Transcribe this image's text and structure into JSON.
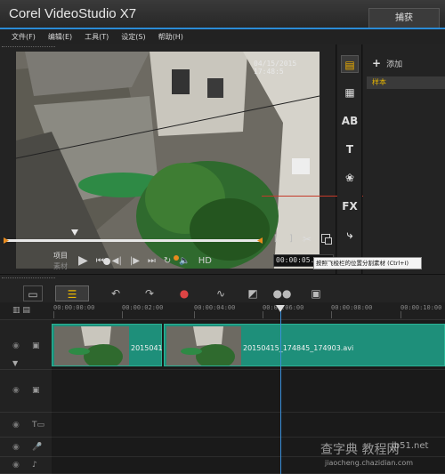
{
  "app": {
    "title": "Corel VideoStudio X7",
    "capture_tab": "捕获"
  },
  "menu": [
    "文件(F)",
    "编辑(E)",
    "工具(T)",
    "设定(S)",
    "帮助(H)"
  ],
  "player": {
    "video_timestamp": "04/15/2015  17:48:5",
    "left_stamp": "1:1:31",
    "mode_project": "项目",
    "mode_clip": "素材",
    "hd_label": "HD",
    "timecode": "00:00:05.",
    "mark_in": "[",
    "mark_out": "]",
    "tooltip": "按照飞梭栏的位置分割素材 (Ctrl+I)"
  },
  "library": {
    "add_label": "添加",
    "add_icon": "+",
    "sample_label": "样本"
  },
  "timeline": {
    "ruler": [
      "00:00:00:00",
      "00:00:02:00",
      "00:00:04:00",
      "00:00:06:00",
      "00:00:08:00",
      "00:00:10:00"
    ],
    "clip1_label": "2015041",
    "clip2_label": "20150415_174845_174903.avi"
  },
  "watermark": {
    "site": "查字典 教程网",
    "site2": "jb51.net",
    "site3": "jiaocheng.chazidian.com"
  },
  "colors": {
    "accent": "#2a8bd6",
    "clip": "#1e8f7a",
    "highlight": "#e8b600",
    "trim": "#e88b1e"
  }
}
